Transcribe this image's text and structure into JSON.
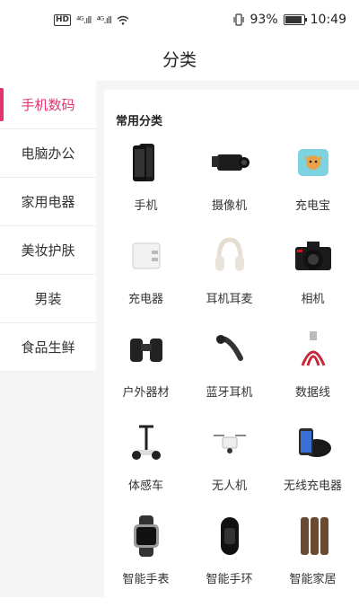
{
  "status_bar": {
    "left_badge": "HD",
    "signal1": "⁴ᴳ.ıll",
    "signal2": "⁴ᴳ.ıll",
    "battery_percent": "93%",
    "battery_level": 0.93,
    "time": "10:49"
  },
  "header": {
    "title": "分类"
  },
  "sidebar": {
    "items": [
      {
        "label": "手机数码",
        "active": true
      },
      {
        "label": "电脑办公",
        "active": false
      },
      {
        "label": "家用电器",
        "active": false
      },
      {
        "label": "美妆护肤",
        "active": false
      },
      {
        "label": "男装",
        "active": false
      },
      {
        "label": "食品生鲜",
        "active": false
      }
    ]
  },
  "main": {
    "section_title": "常用分类",
    "products": [
      {
        "label": "手机",
        "icon": "smartphone-icon"
      },
      {
        "label": "摄像机",
        "icon": "camcorder-icon"
      },
      {
        "label": "充电宝",
        "icon": "power-bank-icon"
      },
      {
        "label": "充电器",
        "icon": "charger-icon"
      },
      {
        "label": "耳机耳麦",
        "icon": "headphones-icon"
      },
      {
        "label": "相机",
        "icon": "camera-icon"
      },
      {
        "label": "户外器材",
        "icon": "binoculars-icon"
      },
      {
        "label": "蓝牙耳机",
        "icon": "bluetooth-earpiece-icon"
      },
      {
        "label": "数据线",
        "icon": "usb-cable-icon"
      },
      {
        "label": "体感车",
        "icon": "balance-scooter-icon"
      },
      {
        "label": "无人机",
        "icon": "drone-icon"
      },
      {
        "label": "无线充电器",
        "icon": "wireless-charger-icon"
      },
      {
        "label": "智能手表",
        "icon": "smartwatch-icon"
      },
      {
        "label": "智能手环",
        "icon": "fitness-band-icon"
      },
      {
        "label": "智能家居",
        "icon": "smart-lock-icon"
      }
    ]
  }
}
